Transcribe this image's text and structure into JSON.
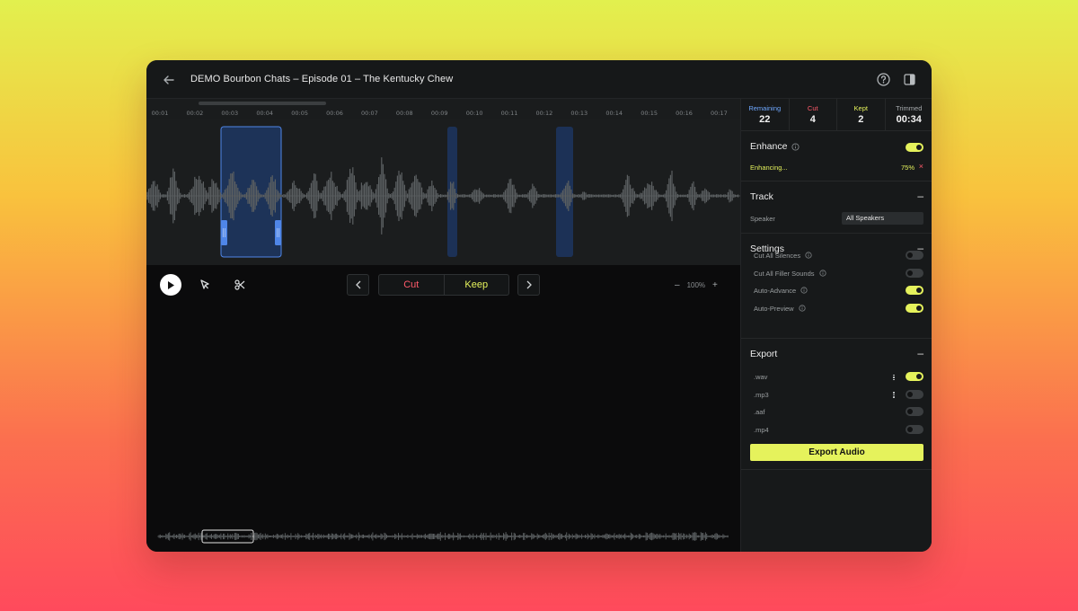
{
  "app": {
    "title": "DEMO Bourbon Chats – Episode 01 – The Kentucky Chew"
  },
  "ruler": {
    "ticks": [
      "00:01",
      "00:02",
      "00:03",
      "00:04",
      "00:05",
      "00:06",
      "00:07",
      "00:08",
      "00:09",
      "00:10",
      "00:11",
      "00:12",
      "00:13",
      "00:14",
      "00:15",
      "00:16",
      "00:17"
    ]
  },
  "stats": {
    "remaining": {
      "label": "Remaining",
      "value": "22",
      "color": "#6fa8ff"
    },
    "cut": {
      "label": "Cut",
      "value": "4",
      "color": "#ff5a6a"
    },
    "kept": {
      "label": "Kept",
      "value": "2",
      "color": "#e5f25c"
    },
    "trimmed": {
      "label": "Trimmed",
      "value": "00:34",
      "color": "#a6aaad"
    }
  },
  "toolbar": {
    "cut_label": "Cut",
    "keep_label": "Keep",
    "zoom_minus": "–",
    "zoom_level": "100%",
    "zoom_plus": "+"
  },
  "enhance": {
    "title": "Enhance",
    "enabled": true,
    "status": "Enhancing...",
    "progress": "75%",
    "cancel": "×"
  },
  "track": {
    "title": "Track",
    "speaker_label": "Speaker",
    "speaker_value": "All Speakers"
  },
  "settings": {
    "title": "Settings",
    "items": [
      {
        "label": "Cut All Silences",
        "on": false
      },
      {
        "label": "Cut All Filler Sounds",
        "on": false
      },
      {
        "label": "Auto-Advance",
        "on": true
      },
      {
        "label": "Auto-Preview",
        "on": true
      }
    ]
  },
  "export": {
    "title": "Export",
    "formats": [
      {
        "label": ".wav",
        "on": true
      },
      {
        "label": ".mp3",
        "on": false
      },
      {
        "label": ".aaf",
        "on": false
      },
      {
        "label": ".mp4",
        "on": false
      }
    ],
    "button_label": "Export Audio"
  },
  "colors": {
    "accent": "#e5f25c",
    "cut": "#ff5a6a",
    "remaining": "#6fa8ff",
    "selection": "#1d3358",
    "waveform": "#5b5f61"
  },
  "section_toggle": "–"
}
